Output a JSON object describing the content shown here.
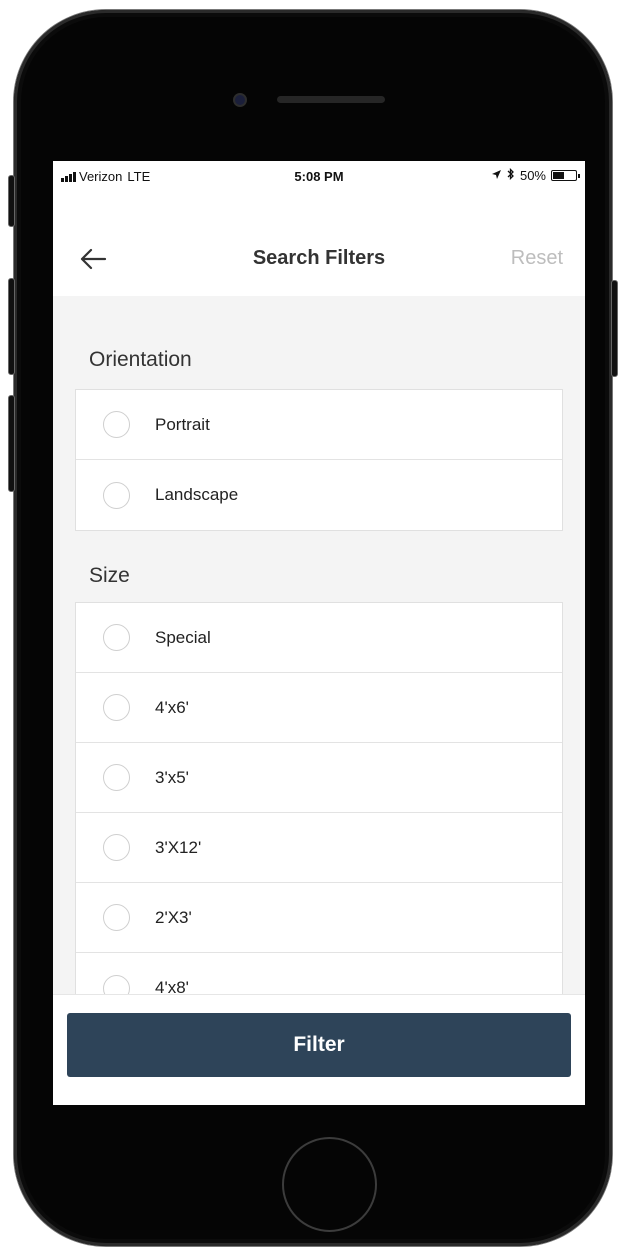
{
  "status_bar": {
    "carrier": "Verizon",
    "network": "LTE",
    "time": "5:08 PM",
    "battery": "50%",
    "battery_level": 0.5,
    "icons": [
      "signal-bars-icon",
      "location-arrow-icon",
      "bluetooth-icon",
      "battery-icon"
    ]
  },
  "header": {
    "back_icon": "arrow-left-icon",
    "title": "Search Filters",
    "reset_label": "Reset"
  },
  "sections": {
    "orientation": {
      "title": "Orientation",
      "options": [
        {
          "label": "Portrait",
          "selected": false
        },
        {
          "label": "Landscape",
          "selected": false
        }
      ]
    },
    "size": {
      "title": "Size",
      "options": [
        {
          "label": "Special",
          "selected": false
        },
        {
          "label": "4'x6'",
          "selected": false
        },
        {
          "label": "3'x5'",
          "selected": false
        },
        {
          "label": "3'X12'",
          "selected": false
        },
        {
          "label": "2'X3'",
          "selected": false
        },
        {
          "label": "4'x8'",
          "selected": false
        }
      ]
    }
  },
  "footer": {
    "filter_label": "Filter"
  },
  "colors": {
    "primary_button": "#2e4459",
    "reset_text": "#bdbdbd",
    "page_background": "#f4f4f4"
  }
}
